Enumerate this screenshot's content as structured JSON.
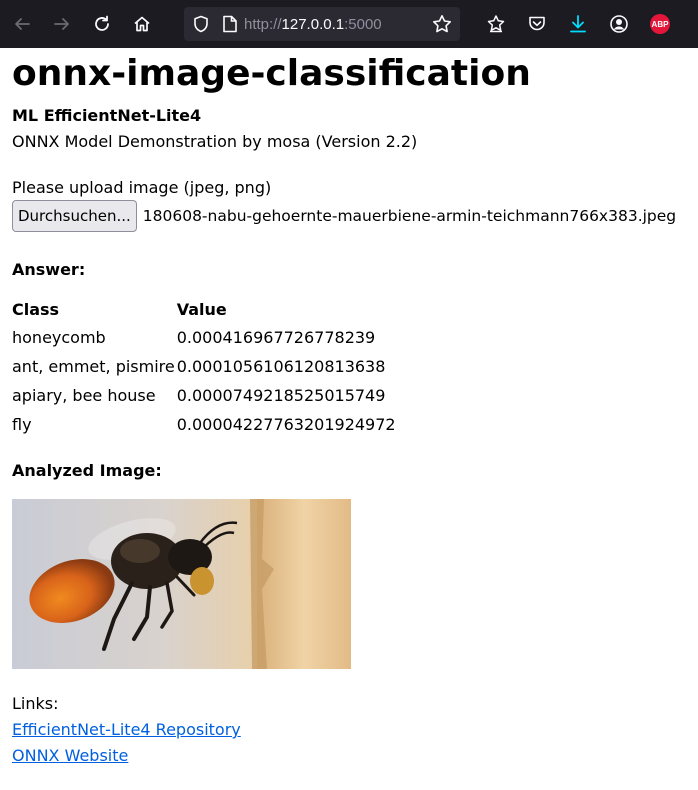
{
  "browser": {
    "url_scheme": "http://",
    "url_host": "127.0.0.1",
    "url_port": ":5000"
  },
  "page": {
    "title": "onnx-image-classification",
    "subtitle": "ML EfficientNet-Lite4",
    "description": "ONNX Model Demonstration by mosa (Version 2.2)",
    "upload_label": "Please upload image (jpeg, png)",
    "browse_button": "Durchsuchen...",
    "file_name": "180608-nabu-gehoernte-mauerbiene-armin-teichmann766x383.jpeg",
    "answer_heading": "Answer:",
    "table": {
      "headers": [
        "Class",
        "Value"
      ],
      "rows": [
        [
          "honeycomb",
          "0.000416967726778239"
        ],
        [
          "ant, emmet, pismire",
          "0.0001056106120813638"
        ],
        [
          "apiary, bee house",
          "0.0000749218525015749"
        ],
        [
          "fly",
          "0.00004227763201924972"
        ]
      ]
    },
    "analyzed_heading": "Analyzed Image:",
    "links_label": "Links:",
    "links": [
      "EfficientNet-Lite4 Repository",
      "ONNX Website"
    ]
  },
  "colors": {
    "toolbar_bg": "#1c1b22",
    "urlbar_bg": "#2b2a33",
    "link": "#0060df",
    "download_icon": "#00ddff",
    "abp_badge": "#e4163a"
  },
  "icons": [
    "back-arrow-icon",
    "forward-arrow-icon",
    "reload-icon",
    "home-icon",
    "shield-icon",
    "page-icon",
    "star-icon",
    "extensions-icon",
    "pocket-icon",
    "download-icon",
    "account-icon",
    "adblock-icon"
  ]
}
